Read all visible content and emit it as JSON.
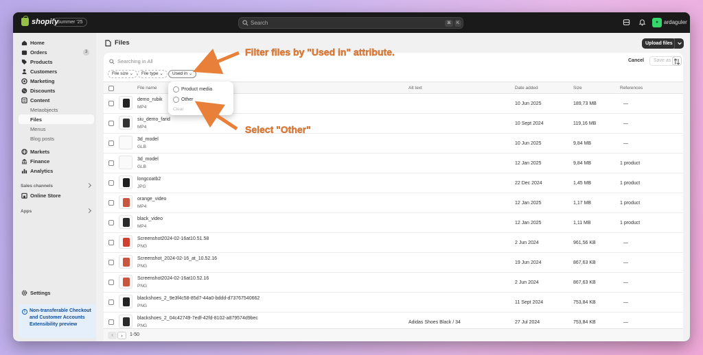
{
  "topbar": {
    "logo": "shopify",
    "edition": "Summer '25",
    "search_placeholder": "Search",
    "kbd1": "⌘",
    "kbd2": "K",
    "username": "ardaguler"
  },
  "sidebar": {
    "items": [
      {
        "label": "Home"
      },
      {
        "label": "Orders",
        "badge": "3"
      },
      {
        "label": "Products"
      },
      {
        "label": "Customers"
      },
      {
        "label": "Marketing"
      },
      {
        "label": "Discounts"
      },
      {
        "label": "Content"
      },
      {
        "label": "Metaobjects"
      },
      {
        "label": "Files"
      },
      {
        "label": "Menus"
      },
      {
        "label": "Blog posts"
      },
      {
        "label": "Markets"
      },
      {
        "label": "Finance"
      },
      {
        "label": "Analytics"
      }
    ],
    "sales_channels_label": "Sales channels",
    "online_store": "Online Store",
    "apps_label": "Apps",
    "settings": "Settings",
    "notice": "Non-transferable Checkout and Customer Accounts Extensibility preview"
  },
  "page": {
    "title": "Files",
    "upload_label": "Upload files"
  },
  "filters": {
    "search_placeholder": "Searching in All",
    "cancel": "Cancel",
    "save_as": "Save as",
    "chips": [
      "File size",
      "File type",
      "Used in"
    ]
  },
  "table": {
    "headers": [
      "File name",
      "Alt text",
      "Date added",
      "Size",
      "References"
    ],
    "rows": [
      {
        "name": "demo_rubik",
        "type": "MP4",
        "alt": "",
        "date": "10 Jun 2025",
        "size": "189,73 MB",
        "refs": "—"
      },
      {
        "name": "siu_demo_farid",
        "type": "MP4",
        "alt": "",
        "date": "10 Sept 2024",
        "size": "119,16 MB",
        "refs": "—"
      },
      {
        "name": "3d_model",
        "type": "GLB",
        "alt": "",
        "date": "10 Jun 2025",
        "size": "9,84 MB",
        "refs": "—"
      },
      {
        "name": "3d_model",
        "type": "GLB",
        "alt": "",
        "date": "12 Jan 2025",
        "size": "9,84 MB",
        "refs": "1 product"
      },
      {
        "name": "longcoatb2",
        "type": "JPG",
        "alt": "",
        "date": "22 Dec 2024",
        "size": "1,45 MB",
        "refs": "1 product"
      },
      {
        "name": "orange_video",
        "type": "MP4",
        "alt": "",
        "date": "12 Jan 2025",
        "size": "1,17 MB",
        "refs": "1 product"
      },
      {
        "name": "black_video",
        "type": "MP4",
        "alt": "",
        "date": "12 Jan 2025",
        "size": "1,11 MB",
        "refs": "1 product"
      },
      {
        "name": "Screenshot2024-02-16at10.51.58",
        "type": "PNG",
        "alt": "",
        "date": "2 Jun 2024",
        "size": "961,56 KB",
        "refs": "—"
      },
      {
        "name": "Screenshot_2024-02-16_at_10.52.16",
        "type": "PNG",
        "alt": "",
        "date": "19 Jun 2024",
        "size": "867,63 KB",
        "refs": "—"
      },
      {
        "name": "Screenshot2024-02-16at10.52.16",
        "type": "PNG",
        "alt": "",
        "date": "2 Jun 2024",
        "size": "867,63 KB",
        "refs": "—"
      },
      {
        "name": "blackshoes_2_9e3f4c58-85d7-44a0-bddd-d73767540662",
        "type": "PNG",
        "alt": "",
        "date": "11 Sept 2024",
        "size": "753,84 KB",
        "refs": "—"
      },
      {
        "name": "blackshoes_2_04c42749-7edf-42fd-8102-a879574d9bec",
        "type": "PNG",
        "alt": "Adidas Shoes Black / 34",
        "date": "27 Jul 2024",
        "size": "753,84 KB",
        "refs": "—"
      }
    ]
  },
  "pagination": {
    "prev": "‹",
    "next": "›",
    "label": "1-50"
  },
  "popover": {
    "options": [
      "Product media",
      "Other"
    ],
    "clear": "Clear"
  },
  "annotations": {
    "top": "Filter files by \"Used in\" attribute.",
    "select": "Select \"Other\""
  },
  "colors": {
    "accent": "#e8803a",
    "sidebar_bg": "#ebebeb",
    "topbar_bg": "#1a1a1a"
  }
}
